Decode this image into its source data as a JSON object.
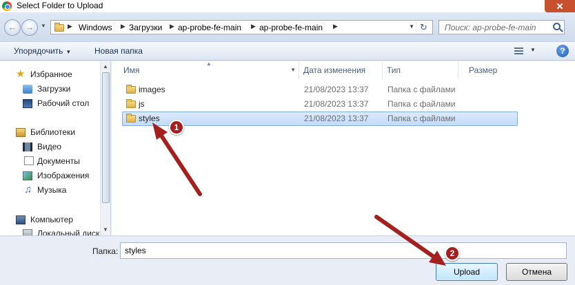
{
  "window": {
    "title": "Select Folder to Upload"
  },
  "address": {
    "crumbs": [
      "Windows",
      "Загрузки",
      "ap-probe-fe-main",
      "ap-probe-fe-main"
    ],
    "search_placeholder": "Поиск: ap-probe-fe-main"
  },
  "toolbar": {
    "organize_label": "Упорядочить",
    "new_folder_label": "Новая папка"
  },
  "sidebar": {
    "items": [
      {
        "label": "Избранное",
        "icon": "star-icon"
      },
      {
        "label": "Загрузки",
        "icon": "downloads-icon"
      },
      {
        "label": "Рабочий стол",
        "icon": "desktop-icon"
      },
      {
        "label": "Библиотеки",
        "icon": "libraries-icon"
      },
      {
        "label": "Видео",
        "icon": "video-icon"
      },
      {
        "label": "Документы",
        "icon": "documents-icon"
      },
      {
        "label": "Изображения",
        "icon": "images-icon"
      },
      {
        "label": "Музыка",
        "icon": "music-icon"
      },
      {
        "label": "Компьютер",
        "icon": "computer-icon"
      },
      {
        "label": "Локальный диск",
        "icon": "disk-icon"
      }
    ]
  },
  "file_list": {
    "columns": {
      "name": "Имя",
      "date": "Дата изменения",
      "type": "Тип",
      "size": "Размер"
    },
    "rows": [
      {
        "name": "images",
        "date": "21/08/2023 13:37",
        "type": "Папка с файлами",
        "selected": false
      },
      {
        "name": "js",
        "date": "21/08/2023 13:37",
        "type": "Папка с файлами",
        "selected": false
      },
      {
        "name": "styles",
        "date": "21/08/2023 13:37",
        "type": "Папка с файлами",
        "selected": true
      }
    ]
  },
  "bottom": {
    "folder_label": "Папка:",
    "folder_value": "styles",
    "upload_label": "Upload",
    "cancel_label": "Отмена"
  },
  "annotations": {
    "badge1": "1",
    "badge2": "2",
    "arrow_color": "#a3201e"
  }
}
